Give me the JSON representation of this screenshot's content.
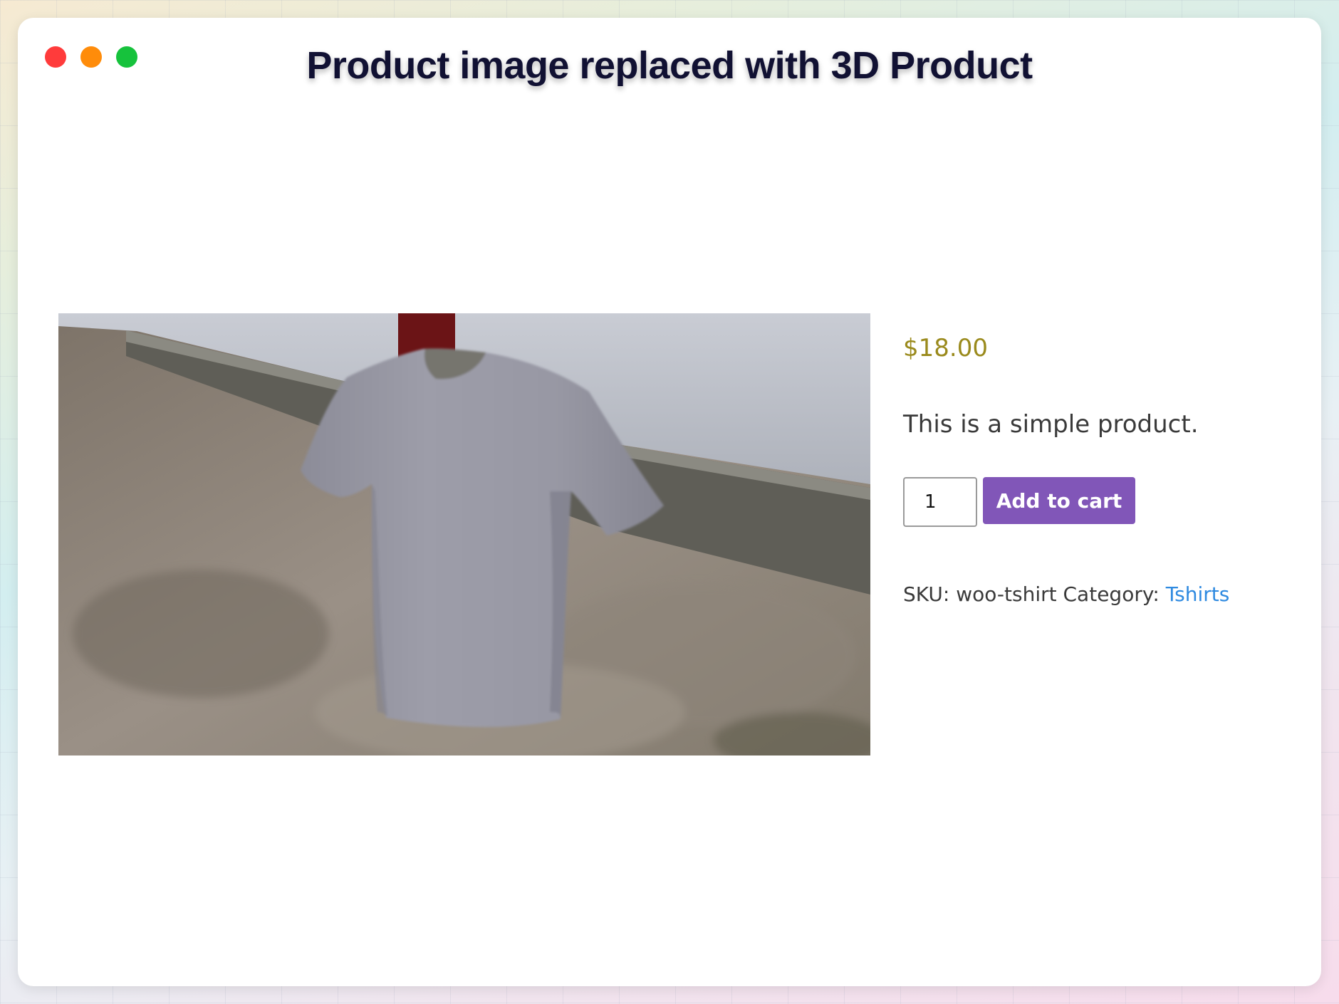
{
  "window": {
    "title": "Product image replaced with 3D Product",
    "controls": [
      {
        "name": "close",
        "color": "#ff3b3b"
      },
      {
        "name": "minimize",
        "color": "#ff8c0a"
      },
      {
        "name": "zoom",
        "color": "#16c23c"
      }
    ]
  },
  "product": {
    "image_icon": "3d-tshirt-model-view",
    "price": "$18.00",
    "description": "This is a simple product.",
    "quantity": "1",
    "add_to_cart_label": "Add to cart",
    "sku_label": "SKU:",
    "sku_value": "woo-tshirt",
    "category_label": "Category:",
    "category_value": "Tshirts"
  },
  "colors": {
    "price": "#9a8a1c",
    "button": "#8156b8",
    "link": "#2f8ae0",
    "title": "#111133"
  }
}
